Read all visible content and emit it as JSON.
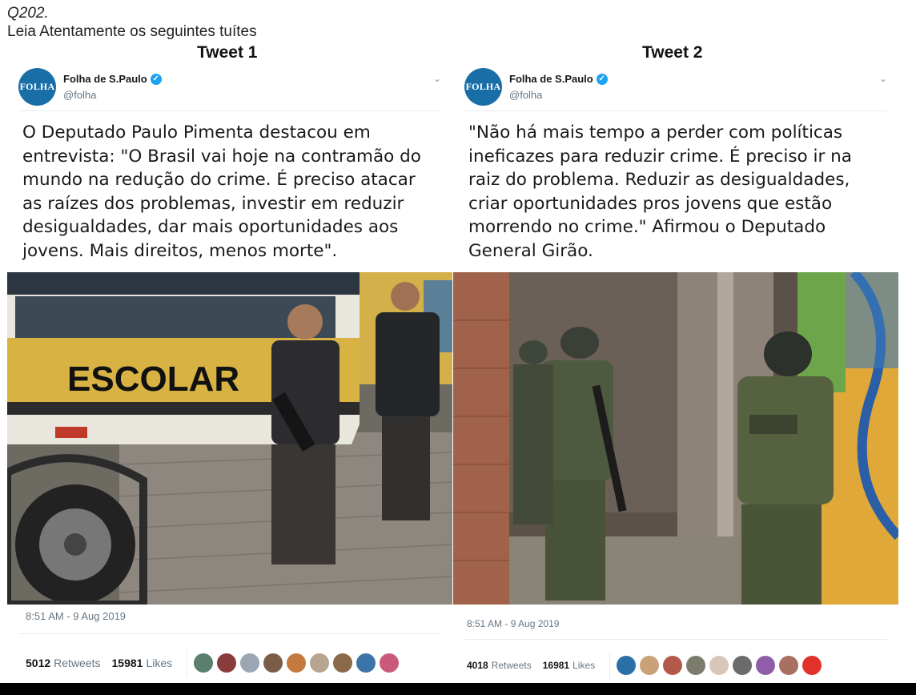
{
  "header": {
    "question_number": "Q202.",
    "instruction": "Leia Atentamente os seguintes tuítes"
  },
  "tweets": [
    {
      "heading": "Tweet 1",
      "account_name": "Folha de S.Paulo",
      "handle": "@folha",
      "avatar_text": "FOLHA",
      "body": "O Deputado Paulo Pimenta destacou em\nentrevista: \"O Brasil vai hoje na contramão do\nmundo na redução do crime. É preciso atacar\nas raízes dos problemas, investir em reduzir\ndesigualdades, dar mais oportunidades aos\njovens. Mais direitos, menos morte\".",
      "photo_text": "ESCOLAR",
      "timestamp": "8:51 AM - 9 Aug 2019",
      "retweets": "5012",
      "retweets_label": "Retweets",
      "likes": "15981",
      "likes_label": "Likes",
      "liker_colors": [
        "#5b7f6e",
        "#8a3b3b",
        "#9aa7b3",
        "#7a5c48",
        "#c47a3e",
        "#b8a590",
        "#8b6a4a",
        "#3c74a8",
        "#c95a7a"
      ]
    },
    {
      "heading": "Tweet 2",
      "account_name": "Folha de S.Paulo",
      "handle": "@folha",
      "avatar_text": "FOLHA",
      "body": "\"Não há mais tempo a perder com políticas\nineficazes para reduzir crime. É preciso ir na\nraiz do problema. Reduzir as desigualdades,\ncriar oportunidades pros jovens que estão\nmorrendo no crime.\" Afirmou o Deputado\nGeneral Girão.",
      "timestamp": "8:51 AM - 9 Aug 2019",
      "retweets": "4018",
      "retweets_label": "Retweets",
      "likes": "16981",
      "likes_label": "Likes",
      "liker_colors": [
        "#2a6fa8",
        "#c9a27a",
        "#b4584a",
        "#7c7c6c",
        "#d8c6b8",
        "#6b6b6b",
        "#8e5fa8",
        "#a87060",
        "#e0312b"
      ]
    }
  ],
  "colors": {
    "twitter_blue": "#1da1f2",
    "folha_blue": "#1a6ea8",
    "muted_text": "#657786"
  }
}
